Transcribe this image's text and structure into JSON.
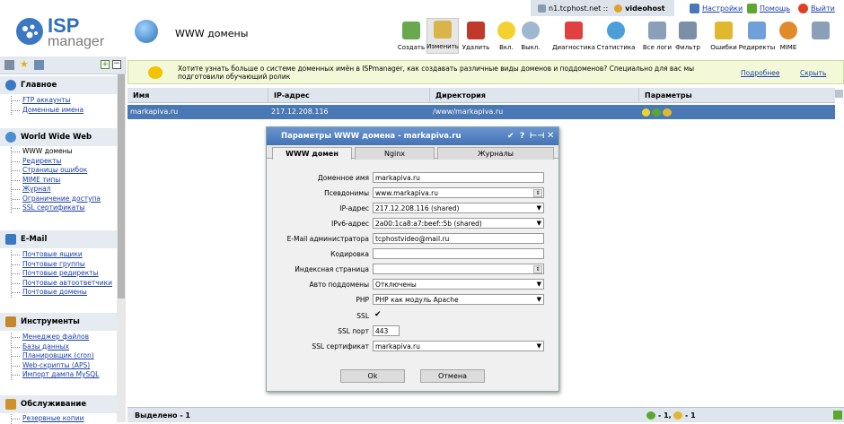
{
  "topbar": {
    "host": "n1.tcphost.net ::",
    "user": "videohost",
    "settings": "Настройки",
    "help": "Помощь",
    "logout": "Выйти"
  },
  "header": {
    "logo_top": "ISP",
    "logo_bottom": "manager",
    "title": "WWW домены"
  },
  "toolbar": {
    "items": [
      {
        "label": "Создать",
        "icon": "create-icon",
        "color": "#6aa84f"
      },
      {
        "label": "Изменить",
        "icon": "edit-icon",
        "color": "#d9b44a"
      },
      {
        "label": "Удалить",
        "icon": "delete-icon",
        "color": "#c0392b"
      },
      {
        "label": "Вкл.",
        "icon": "bulb-on-icon",
        "color": "#f2d22e"
      },
      {
        "label": "Выкл.",
        "icon": "bulb-off-icon",
        "color": "#9fb7cf"
      },
      {
        "label": "Диагностика",
        "icon": "diagnostics-icon",
        "color": "#e04040"
      },
      {
        "label": "Статистика",
        "icon": "stats-icon",
        "color": "#4a9fd8"
      },
      {
        "label": "Все логи",
        "icon": "logs-icon",
        "color": "#8aa0b8"
      },
      {
        "label": "Фильтр",
        "icon": "filter-icon",
        "color": "#7b8fa8"
      },
      {
        "label": "Ошибки",
        "icon": "errors-icon",
        "color": "#e0b830"
      },
      {
        "label": "Редиректы",
        "icon": "redirects-icon",
        "color": "#6fa0d8"
      },
      {
        "label": "MIME",
        "icon": "mime-icon",
        "color": "#e08a2a"
      },
      {
        "label": "",
        "icon": "exit-list-icon",
        "color": "#8aa0b8"
      }
    ]
  },
  "sidebar": {
    "groups": [
      {
        "title": "Главное",
        "items": [
          "FTP аккаунты",
          "Доменные имена"
        ]
      },
      {
        "title": "World Wide Web",
        "items": [
          "WWW домены",
          "Редиректы",
          "Страницы ошибок",
          "MIME типы",
          "Журнал",
          "Ограничение доступа",
          "SSL сертификаты"
        ]
      },
      {
        "title": "E-Mail",
        "items": [
          "Почтовые ящики",
          "Почтовые группы",
          "Почтовые редиректы",
          "Почтовые автоответчики",
          "Почтовые домены"
        ]
      },
      {
        "title": "Инструменты",
        "items": [
          "Менеджер файлов",
          "Базы данных",
          "Планировщик (cron)",
          "Web-скрипты (APS)",
          "Импорт дампа MySQL"
        ]
      },
      {
        "title": "Обслуживание",
        "items": [
          "Резервные копии"
        ]
      }
    ]
  },
  "info": {
    "text": "Хотите узнать больше о системе доменных имён в ISPmanager, как создавать различные виды доменов и поддоменов? Специально для вас мы подготовили обучающий ролик",
    "more": "Подробнее",
    "hide": "Скрыть"
  },
  "grid": {
    "columns": [
      "Имя",
      "IP-адрес",
      "Директория",
      "Параметры"
    ],
    "rows": [
      {
        "name": "markapiva.ru",
        "ip": "217.12.208.116",
        "dir": "/www/markapiva.ru"
      }
    ]
  },
  "footer": {
    "selected": "Выделено - 1",
    "summary_a": "- 1,",
    "summary_b": "- 1"
  },
  "dialog": {
    "title": "Параметры WWW домена - markapiva.ru",
    "tabs": [
      "WWW домен",
      "Nginx",
      "Журналы"
    ],
    "fields": {
      "domain_label": "Доменное имя",
      "domain_value": "markapiva.ru",
      "alias_label": "Псевдонимы",
      "alias_value": "www.markapiva.ru",
      "ip_label": "IP-адрес",
      "ip_value": "217.12.208.116 (shared)",
      "ipv6_label": "IPv6-адрес",
      "ipv6_value": "2a00:1ca8:a7:beef::5b (shared)",
      "email_label": "E-Mail администратора",
      "email_value": "tcphostvideo@mail.ru",
      "charset_label": "Кодировка",
      "charset_value": "",
      "index_label": "Индексная страница",
      "index_value": "",
      "autosub_label": "Авто поддомены",
      "autosub_value": "Отключены",
      "php_label": "PHP",
      "php_value": "PHP как модуль Apache",
      "ssl_label": "SSL",
      "sslport_label": "SSL порт",
      "sslport_value": "443",
      "sslcert_label": "SSL сертификат",
      "sslcert_value": "markapiva.ru"
    },
    "ok": "Ok",
    "cancel": "Отмена"
  }
}
